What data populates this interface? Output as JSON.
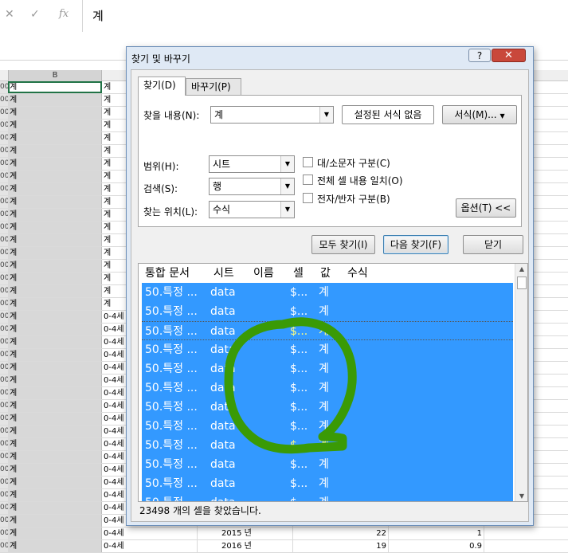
{
  "formula_bar": {
    "cancel_glyph": "✕",
    "enter_glyph": "✓",
    "fx_glyph": "fx",
    "value": "계"
  },
  "column_b_header": "B",
  "grid_rows": [
    {
      "rn": "00",
      "b": "계",
      "c": "계"
    },
    {
      "rn": "00",
      "b": "계",
      "c": "계"
    },
    {
      "rn": "00",
      "b": "계",
      "c": "계"
    },
    {
      "rn": "00",
      "b": "계",
      "c": "계"
    },
    {
      "rn": "00",
      "b": "계",
      "c": "계"
    },
    {
      "rn": "00",
      "b": "계",
      "c": "계"
    },
    {
      "rn": "00",
      "b": "계",
      "c": "계"
    },
    {
      "rn": "00",
      "b": "계",
      "c": "계"
    },
    {
      "rn": "00",
      "b": "계",
      "c": "계"
    },
    {
      "rn": "00",
      "b": "계",
      "c": "계"
    },
    {
      "rn": "00",
      "b": "계",
      "c": "계"
    },
    {
      "rn": "00",
      "b": "계",
      "c": "계"
    },
    {
      "rn": "00",
      "b": "계",
      "c": "계"
    },
    {
      "rn": "00",
      "b": "계",
      "c": "계"
    },
    {
      "rn": "00",
      "b": "계",
      "c": "계"
    },
    {
      "rn": "00",
      "b": "계",
      "c": "계"
    },
    {
      "rn": "00",
      "b": "계",
      "c": "계"
    },
    {
      "rn": "00",
      "b": "계",
      "c": "계"
    },
    {
      "rn": "00",
      "b": "계",
      "c": "0-4세"
    },
    {
      "rn": "00",
      "b": "계",
      "c": "0-4세"
    },
    {
      "rn": "00",
      "b": "계",
      "c": "0-4세"
    },
    {
      "rn": "00",
      "b": "계",
      "c": "0-4세"
    },
    {
      "rn": "00",
      "b": "계",
      "c": "0-4세"
    },
    {
      "rn": "00",
      "b": "계",
      "c": "0-4세"
    },
    {
      "rn": "00",
      "b": "계",
      "c": "0-4세"
    },
    {
      "rn": "00",
      "b": "계",
      "c": "0-4세"
    },
    {
      "rn": "00",
      "b": "계",
      "c": "0-4세"
    },
    {
      "rn": "00",
      "b": "계",
      "c": "0-4세"
    },
    {
      "rn": "00",
      "b": "계",
      "c": "0-4세"
    },
    {
      "rn": "00",
      "b": "계",
      "c": "0-4세"
    },
    {
      "rn": "00",
      "b": "계",
      "c": "0-4세"
    },
    {
      "rn": "00",
      "b": "계",
      "c": "0-4세"
    },
    {
      "rn": "00",
      "b": "계",
      "c": "0-4세"
    },
    {
      "rn": "00",
      "b": "계",
      "c": "0-4세"
    },
    {
      "rn": "00",
      "b": "계",
      "c": "0-4세"
    },
    {
      "rn": "00",
      "b": "계",
      "c": "0-4세",
      "d": "2015 년",
      "e": "22",
      "f": "1"
    },
    {
      "rn": "00",
      "b": "계",
      "c": "0-4세",
      "d": "2016 년",
      "e": "19",
      "f": "0.9"
    }
  ],
  "dialog": {
    "title": "찾기 및 바꾸기",
    "help_label": "?",
    "close_label": "✕",
    "tabs": [
      "찾기(D)",
      "바꾸기(P)"
    ],
    "find_what_label": "찾을 내용(N):",
    "find_what_value": "계",
    "format_preview": "설정된 서식 없음",
    "format_button": "서식(M)...",
    "within_label": "범위(H):",
    "within_value": "시트",
    "search_label": "검색(S):",
    "search_value": "행",
    "look_in_label": "찾는 위치(L):",
    "look_in_value": "수식",
    "match_case_label": "대/소문자 구분(C)",
    "match_entire_label": "전체 셀 내용 일치(O)",
    "match_byte_label": "전자/반자 구분(B)",
    "options_button": "옵션(T) <<",
    "find_all_button": "모두 찾기(I)",
    "find_next_button": "다음 찾기(F)",
    "close_button": "닫기",
    "results_columns": [
      "통합 문서",
      "시트",
      "이름",
      "셀",
      "값",
      "수식"
    ],
    "results": [
      {
        "book": "50.특정 ...",
        "sheet": "data",
        "cell": "$...",
        "value": "계"
      },
      {
        "book": "50.특정 ...",
        "sheet": "data",
        "cell": "$...",
        "value": "계"
      },
      {
        "book": "50.특정 ...",
        "sheet": "data",
        "cell": "$...",
        "value": "계"
      },
      {
        "book": "50.특정 ...",
        "sheet": "data",
        "cell": "$...",
        "value": "계"
      },
      {
        "book": "50.특정 ...",
        "sheet": "data",
        "cell": "$...",
        "value": "계"
      },
      {
        "book": "50.특정 ...",
        "sheet": "data",
        "cell": "$...",
        "value": "계"
      },
      {
        "book": "50.특정 ...",
        "sheet": "data",
        "cell": "$...",
        "value": "계"
      },
      {
        "book": "50.특정 ...",
        "sheet": "data",
        "cell": "$...",
        "value": "계"
      },
      {
        "book": "50.특정 ...",
        "sheet": "data",
        "cell": "$...",
        "value": "계"
      },
      {
        "book": "50.특정 ...",
        "sheet": "data",
        "cell": "$...",
        "value": "계"
      },
      {
        "book": "50.특정 ...",
        "sheet": "data",
        "cell": "$...",
        "value": "계"
      },
      {
        "book": "50.특정 ...",
        "sheet": "data",
        "cell": "$...",
        "value": "계"
      }
    ],
    "status": "23498 개의 셀을 찾았습니다."
  },
  "colors": {
    "selection": "#3399ff",
    "annotation": "#3a9a06"
  }
}
